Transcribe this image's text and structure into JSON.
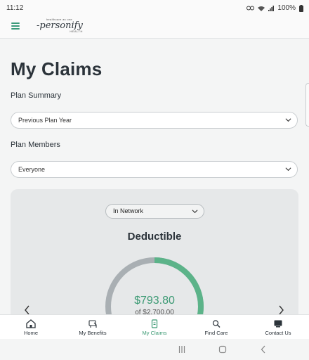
{
  "status_bar": {
    "time": "11:12",
    "battery": "100%"
  },
  "app_bar": {
    "logo_tagline": "healthcare as one",
    "logo_brand": "personify",
    "logo_sub": "HEALTH"
  },
  "page": {
    "title": "My Claims",
    "plan_summary_label": "Plan Summary",
    "plan_summary_value": "Previous Plan Year",
    "plan_members_label": "Plan Members",
    "plan_members_value": "Everyone"
  },
  "card": {
    "network_value": "In Network",
    "title": "Deductible",
    "amount": "$793.80",
    "of_total": "of $2,700.00",
    "progress_fraction": 0.294,
    "colors": {
      "filled": "#5cb389",
      "remaining": "#a9afb3"
    }
  },
  "bottom_nav": {
    "items": [
      {
        "label": "Home",
        "icon": "home-icon"
      },
      {
        "label": "My Benefits",
        "icon": "benefits-icon"
      },
      {
        "label": "My Claims",
        "icon": "claims-icon"
      },
      {
        "label": "Find Care",
        "icon": "find-care-icon"
      },
      {
        "label": "Contact Us",
        "icon": "contact-icon"
      }
    ],
    "active": "My Claims"
  },
  "accent_color": "#3c9a74"
}
